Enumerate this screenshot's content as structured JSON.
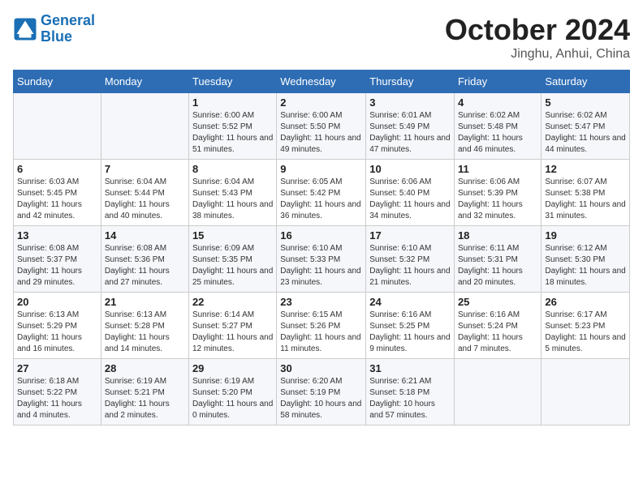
{
  "header": {
    "logo_line1": "General",
    "logo_line2": "Blue",
    "month": "October 2024",
    "location": "Jinghu, Anhui, China"
  },
  "days_of_week": [
    "Sunday",
    "Monday",
    "Tuesday",
    "Wednesday",
    "Thursday",
    "Friday",
    "Saturday"
  ],
  "weeks": [
    [
      {
        "day": "",
        "info": ""
      },
      {
        "day": "",
        "info": ""
      },
      {
        "day": "1",
        "info": "Sunrise: 6:00 AM\nSunset: 5:52 PM\nDaylight: 11 hours and 51 minutes."
      },
      {
        "day": "2",
        "info": "Sunrise: 6:00 AM\nSunset: 5:50 PM\nDaylight: 11 hours and 49 minutes."
      },
      {
        "day": "3",
        "info": "Sunrise: 6:01 AM\nSunset: 5:49 PM\nDaylight: 11 hours and 47 minutes."
      },
      {
        "day": "4",
        "info": "Sunrise: 6:02 AM\nSunset: 5:48 PM\nDaylight: 11 hours and 46 minutes."
      },
      {
        "day": "5",
        "info": "Sunrise: 6:02 AM\nSunset: 5:47 PM\nDaylight: 11 hours and 44 minutes."
      }
    ],
    [
      {
        "day": "6",
        "info": "Sunrise: 6:03 AM\nSunset: 5:45 PM\nDaylight: 11 hours and 42 minutes."
      },
      {
        "day": "7",
        "info": "Sunrise: 6:04 AM\nSunset: 5:44 PM\nDaylight: 11 hours and 40 minutes."
      },
      {
        "day": "8",
        "info": "Sunrise: 6:04 AM\nSunset: 5:43 PM\nDaylight: 11 hours and 38 minutes."
      },
      {
        "day": "9",
        "info": "Sunrise: 6:05 AM\nSunset: 5:42 PM\nDaylight: 11 hours and 36 minutes."
      },
      {
        "day": "10",
        "info": "Sunrise: 6:06 AM\nSunset: 5:40 PM\nDaylight: 11 hours and 34 minutes."
      },
      {
        "day": "11",
        "info": "Sunrise: 6:06 AM\nSunset: 5:39 PM\nDaylight: 11 hours and 32 minutes."
      },
      {
        "day": "12",
        "info": "Sunrise: 6:07 AM\nSunset: 5:38 PM\nDaylight: 11 hours and 31 minutes."
      }
    ],
    [
      {
        "day": "13",
        "info": "Sunrise: 6:08 AM\nSunset: 5:37 PM\nDaylight: 11 hours and 29 minutes."
      },
      {
        "day": "14",
        "info": "Sunrise: 6:08 AM\nSunset: 5:36 PM\nDaylight: 11 hours and 27 minutes."
      },
      {
        "day": "15",
        "info": "Sunrise: 6:09 AM\nSunset: 5:35 PM\nDaylight: 11 hours and 25 minutes."
      },
      {
        "day": "16",
        "info": "Sunrise: 6:10 AM\nSunset: 5:33 PM\nDaylight: 11 hours and 23 minutes."
      },
      {
        "day": "17",
        "info": "Sunrise: 6:10 AM\nSunset: 5:32 PM\nDaylight: 11 hours and 21 minutes."
      },
      {
        "day": "18",
        "info": "Sunrise: 6:11 AM\nSunset: 5:31 PM\nDaylight: 11 hours and 20 minutes."
      },
      {
        "day": "19",
        "info": "Sunrise: 6:12 AM\nSunset: 5:30 PM\nDaylight: 11 hours and 18 minutes."
      }
    ],
    [
      {
        "day": "20",
        "info": "Sunrise: 6:13 AM\nSunset: 5:29 PM\nDaylight: 11 hours and 16 minutes."
      },
      {
        "day": "21",
        "info": "Sunrise: 6:13 AM\nSunset: 5:28 PM\nDaylight: 11 hours and 14 minutes."
      },
      {
        "day": "22",
        "info": "Sunrise: 6:14 AM\nSunset: 5:27 PM\nDaylight: 11 hours and 12 minutes."
      },
      {
        "day": "23",
        "info": "Sunrise: 6:15 AM\nSunset: 5:26 PM\nDaylight: 11 hours and 11 minutes."
      },
      {
        "day": "24",
        "info": "Sunrise: 6:16 AM\nSunset: 5:25 PM\nDaylight: 11 hours and 9 minutes."
      },
      {
        "day": "25",
        "info": "Sunrise: 6:16 AM\nSunset: 5:24 PM\nDaylight: 11 hours and 7 minutes."
      },
      {
        "day": "26",
        "info": "Sunrise: 6:17 AM\nSunset: 5:23 PM\nDaylight: 11 hours and 5 minutes."
      }
    ],
    [
      {
        "day": "27",
        "info": "Sunrise: 6:18 AM\nSunset: 5:22 PM\nDaylight: 11 hours and 4 minutes."
      },
      {
        "day": "28",
        "info": "Sunrise: 6:19 AM\nSunset: 5:21 PM\nDaylight: 11 hours and 2 minutes."
      },
      {
        "day": "29",
        "info": "Sunrise: 6:19 AM\nSunset: 5:20 PM\nDaylight: 11 hours and 0 minutes."
      },
      {
        "day": "30",
        "info": "Sunrise: 6:20 AM\nSunset: 5:19 PM\nDaylight: 10 hours and 58 minutes."
      },
      {
        "day": "31",
        "info": "Sunrise: 6:21 AM\nSunset: 5:18 PM\nDaylight: 10 hours and 57 minutes."
      },
      {
        "day": "",
        "info": ""
      },
      {
        "day": "",
        "info": ""
      }
    ]
  ]
}
